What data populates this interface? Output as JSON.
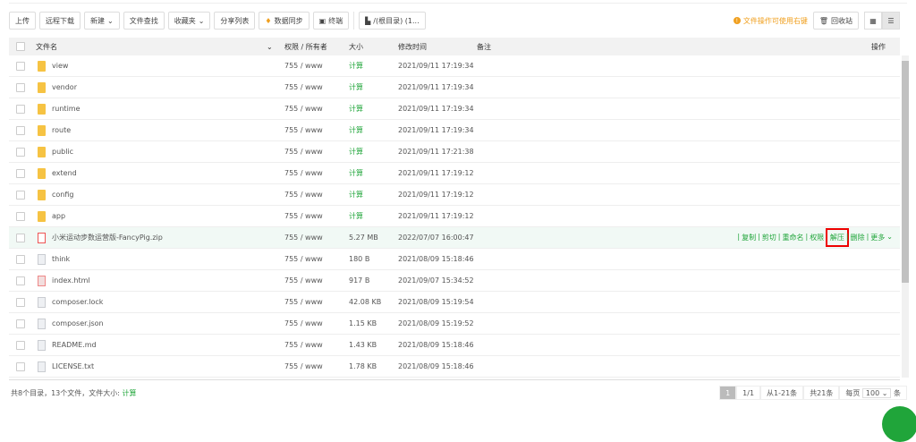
{
  "toolbar": {
    "upload": "上传",
    "remote_download": "远程下载",
    "new": "新建",
    "find": "文件查找",
    "favorites": "收藏夹",
    "share_list": "分享列表",
    "sync": "数据同步",
    "terminal": "终端",
    "path": "/(根目录) (1..."
  },
  "right": {
    "tip": "文件操作可使用右键",
    "recycle": "回收站"
  },
  "columns": {
    "name": "文件名",
    "perms": "权限 / 所有者",
    "size": "大小",
    "mtime": "修改时间",
    "note": "备注",
    "ops": "操作"
  },
  "rows": [
    {
      "name": "view",
      "type": "folder",
      "perms": "755 / www",
      "size": "计算",
      "mtime": "2021/09/11 17:19:34"
    },
    {
      "name": "vendor",
      "type": "folder",
      "perms": "755 / www",
      "size": "计算",
      "mtime": "2021/09/11 17:19:34"
    },
    {
      "name": "runtime",
      "type": "folder",
      "perms": "755 / www",
      "size": "计算",
      "mtime": "2021/09/11 17:19:34"
    },
    {
      "name": "route",
      "type": "folder",
      "perms": "755 / www",
      "size": "计算",
      "mtime": "2021/09/11 17:19:34"
    },
    {
      "name": "public",
      "type": "folder",
      "perms": "755 / www",
      "size": "计算",
      "mtime": "2021/09/11 17:21:38"
    },
    {
      "name": "extend",
      "type": "folder",
      "perms": "755 / www",
      "size": "计算",
      "mtime": "2021/09/11 17:19:12"
    },
    {
      "name": "config",
      "type": "folder",
      "perms": "755 / www",
      "size": "计算",
      "mtime": "2021/09/11 17:19:12"
    },
    {
      "name": "app",
      "type": "folder",
      "perms": "755 / www",
      "size": "计算",
      "mtime": "2021/09/11 17:19:12"
    },
    {
      "name": "小米运动步数运营版-FancyPig.zip",
      "type": "zip",
      "perms": "755 / www",
      "size": "5.27 MB",
      "mtime": "2022/07/07 16:00:47"
    },
    {
      "name": "think",
      "type": "file",
      "perms": "755 / www",
      "size": "180 B",
      "mtime": "2021/08/09 15:18:46"
    },
    {
      "name": "index.html",
      "type": "html",
      "perms": "755 / www",
      "size": "917 B",
      "mtime": "2021/09/07 15:34:52"
    },
    {
      "name": "composer.lock",
      "type": "file",
      "perms": "755 / www",
      "size": "42.08 KB",
      "mtime": "2021/08/09 15:19:54"
    },
    {
      "name": "composer.json",
      "type": "file",
      "perms": "755 / www",
      "size": "1.15 KB",
      "mtime": "2021/08/09 15:19:52"
    },
    {
      "name": "README.md",
      "type": "file",
      "perms": "755 / www",
      "size": "1.43 KB",
      "mtime": "2021/08/09 15:18:46"
    },
    {
      "name": "LICENSE.txt",
      "type": "file",
      "perms": "755 / www",
      "size": "1.78 KB",
      "mtime": "2021/08/09 15:18:46"
    }
  ],
  "ops": [
    "复制",
    "剪切",
    "重命名",
    "权限",
    "解压",
    "删除",
    "更多"
  ],
  "footer": {
    "summary": "共8个目录，13个文件，文件大小:",
    "calc": "计算"
  },
  "pager": {
    "current": "1",
    "pages": "1/1",
    "range": "从1-21条",
    "total": "共21条",
    "per_page_label": "每页",
    "per_page": "100",
    "unit": "条"
  },
  "colors": {
    "accent": "#20a53a",
    "highlight": "#e00000"
  }
}
